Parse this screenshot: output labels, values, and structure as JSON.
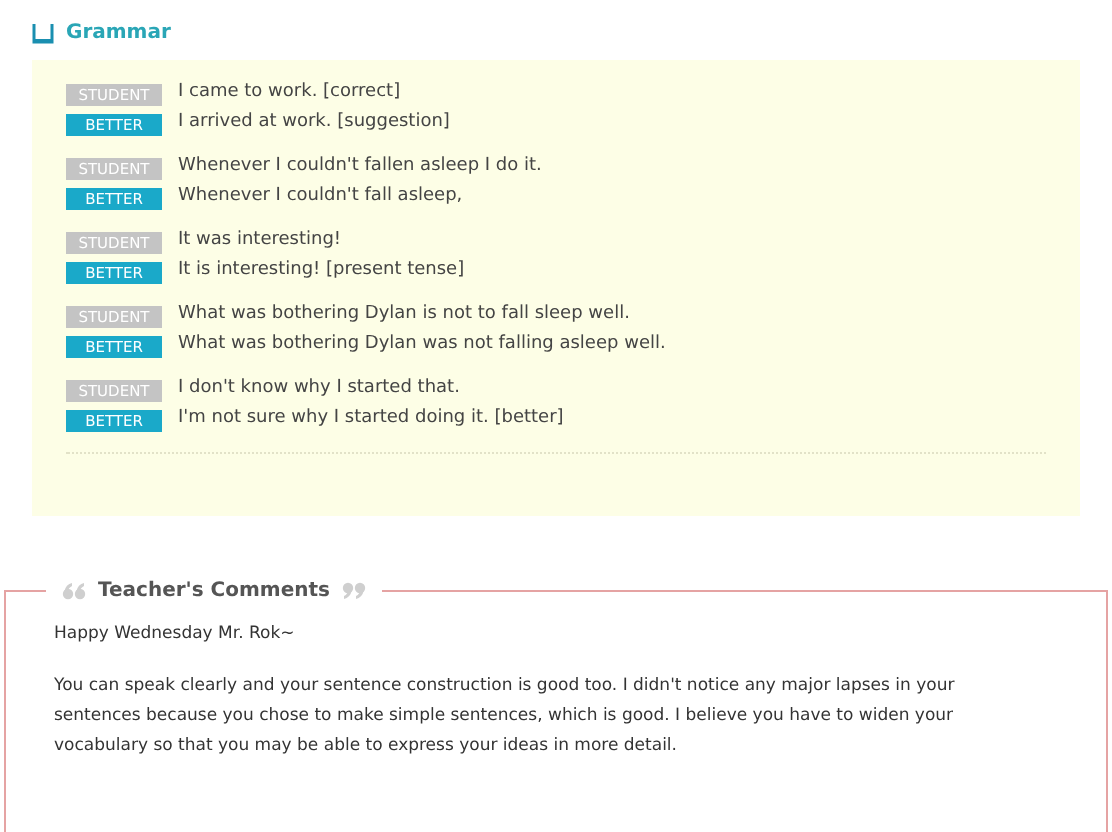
{
  "grammar": {
    "title": "Grammar",
    "pairs": [
      {
        "lines": [
          {
            "kind": "student",
            "tag": "STUDENT",
            "text": "I came to work. [correct]"
          },
          {
            "kind": "better",
            "tag": "BETTER",
            "text": "I arrived at work. [suggestion]"
          }
        ]
      },
      {
        "lines": [
          {
            "kind": "student",
            "tag": "STUDENT",
            "text": "Whenever I couldn't fallen asleep I do it."
          },
          {
            "kind": "better",
            "tag": "BETTER",
            "text": "Whenever I couldn't fall asleep,"
          }
        ]
      },
      {
        "lines": [
          {
            "kind": "student",
            "tag": "STUDENT",
            "text": "It was interesting!"
          },
          {
            "kind": "better",
            "tag": "BETTER",
            "text": "It is interesting! [present tense]"
          }
        ]
      },
      {
        "lines": [
          {
            "kind": "student",
            "tag": "STUDENT",
            "text": "What was bothering Dylan is not to fall sleep well."
          },
          {
            "kind": "better",
            "tag": "BETTER",
            "text": "What was bothering Dylan was not falling asleep well."
          }
        ]
      },
      {
        "lines": [
          {
            "kind": "student",
            "tag": "STUDENT",
            "text": "I don't know why I started that."
          },
          {
            "kind": "better",
            "tag": "BETTER",
            "text": "I'm not sure why I started doing it. [better]"
          }
        ]
      }
    ]
  },
  "comments": {
    "title": "Teacher's Comments",
    "greeting": "Happy Wednesday Mr. Rok~",
    "body": "You can speak clearly and your sentence construction is good too. I didn't notice any major lapses in your sentences because you chose to make simple sentences, which is good. I believe you have to widen your vocabulary so that you may be able to express your ideas in more detail."
  }
}
